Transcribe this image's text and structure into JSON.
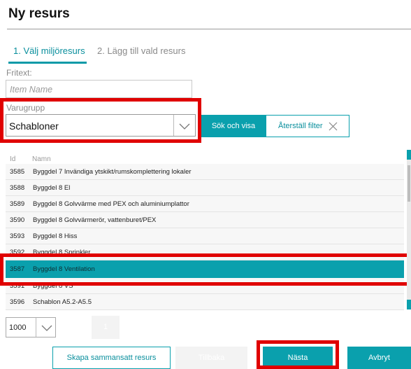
{
  "page": {
    "title": "Ny resurs"
  },
  "tabs": [
    {
      "label": "1. Välj miljöresurs"
    },
    {
      "label": "2. Lägg till vald resurs"
    }
  ],
  "filters": {
    "fritext_label": "Fritext:",
    "fritext_placeholder": "Item Name",
    "varugrupp_label": "Varugrupp",
    "varugrupp_value": "Schabloner",
    "search_button": "Sök och visa",
    "reset_button": "Återställ filter"
  },
  "table": {
    "columns": {
      "id": "Id",
      "name": "Namn"
    },
    "rows": [
      {
        "id": "3585",
        "name": "Byggdel 7 Invändiga ytskikt/rumskomplettering lokaler"
      },
      {
        "id": "3588",
        "name": "Byggdel 8 El"
      },
      {
        "id": "3589",
        "name": "Byggdel 8 Golvvärme med PEX och aluminiumplattor"
      },
      {
        "id": "3590",
        "name": "Byggdel 8 Golvvärmerör, vattenburet/PEX"
      },
      {
        "id": "3593",
        "name": "Byggdel 8 Hiss"
      },
      {
        "id": "3592",
        "name": "Byggdel 8 Sprinkler"
      },
      {
        "id": "3587",
        "name": "Byggdel 8 Ventilation",
        "selected": true
      },
      {
        "id": "3591",
        "name": "Byggdel 8 VS"
      },
      {
        "id": "3596",
        "name": "Schablon A5.2-A5.5"
      }
    ]
  },
  "pagination": {
    "page_size": "1000",
    "current_page": "1"
  },
  "actions": {
    "create_combined": "Skapa sammansatt resurs",
    "back": "Tillbaka",
    "next": "Nästa",
    "cancel": "Avbryt"
  },
  "colors": {
    "accent": "#0aa0ad",
    "highlight": "#e00000"
  }
}
